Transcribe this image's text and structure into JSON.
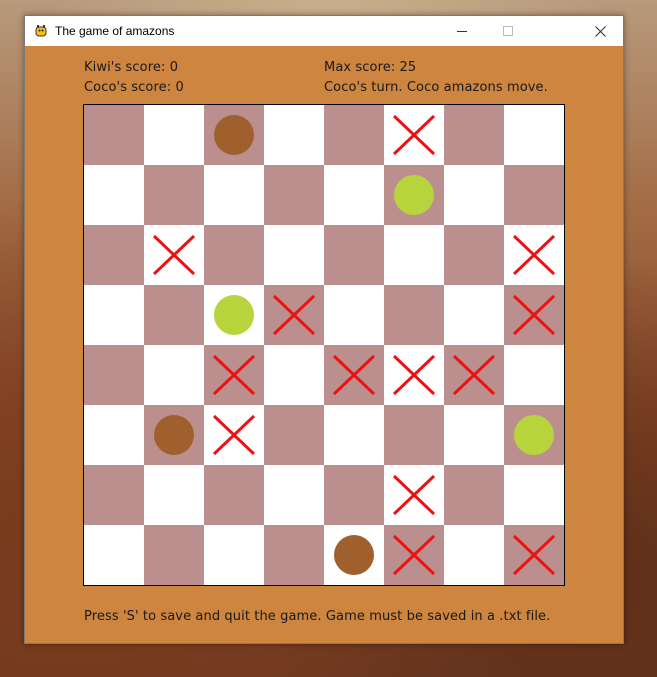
{
  "window": {
    "title": "The game of amazons",
    "icon": "pygame-snake-icon",
    "controls": {
      "minimize_glyph": "—",
      "maximize_glyph": "☐",
      "close_glyph": "✕"
    }
  },
  "scores": {
    "kiwi_label": "Kiwi's score: 0",
    "coco_label": "Coco's score: 0",
    "max_label": "Max score:  25"
  },
  "status": {
    "turn_text": "Coco's turn. Coco amazons move."
  },
  "footer": {
    "text": "Press 'S' to save and quit the game. Game must be saved in a .txt file."
  },
  "colors": {
    "window_bg": "#cd853f",
    "dark_square": "#bc8f8f",
    "light_square": "#ffffff",
    "kiwi_piece": "#a0602e",
    "coco_piece": "#b8d43c",
    "blocked_mark": "#ee1111"
  },
  "board": {
    "size": 8,
    "legend": {
      "K": "kiwi-amazon",
      "C": "coco-amazon",
      "X": "blocked-square",
      ".": "empty"
    },
    "rows": [
      "..K..X..",
      ".....C..",
      ".X.....X",
      "..CX...X",
      "..X.XXX.",
      ".KX....C",
      ".....X..",
      "....KX.X"
    ]
  }
}
